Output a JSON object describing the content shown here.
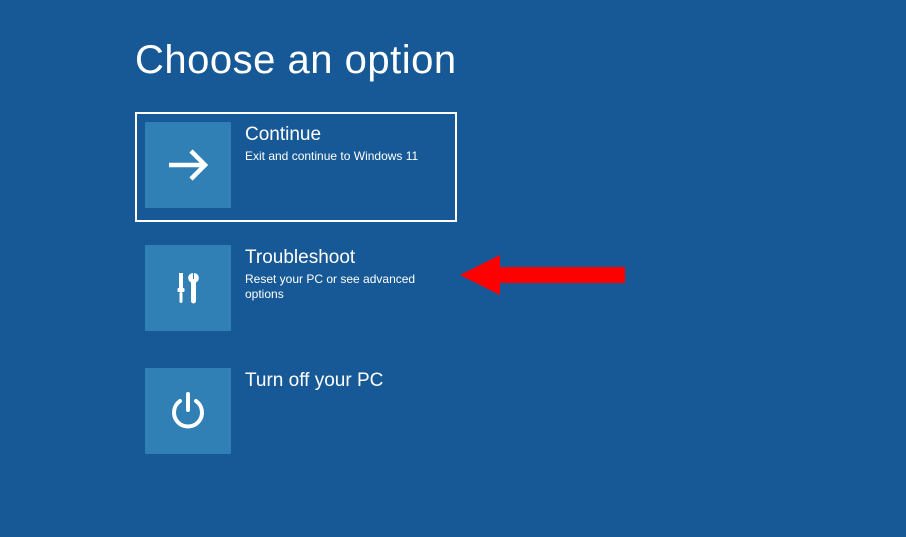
{
  "page": {
    "title": "Choose an option"
  },
  "options": {
    "continue": {
      "title": "Continue",
      "description": "Exit and continue to Windows 11",
      "icon": "arrow-right-icon"
    },
    "troubleshoot": {
      "title": "Troubleshoot",
      "description": "Reset your PC or see advanced options",
      "icon": "tools-icon"
    },
    "turnoff": {
      "title": "Turn off your PC",
      "description": "",
      "icon": "power-icon"
    }
  }
}
